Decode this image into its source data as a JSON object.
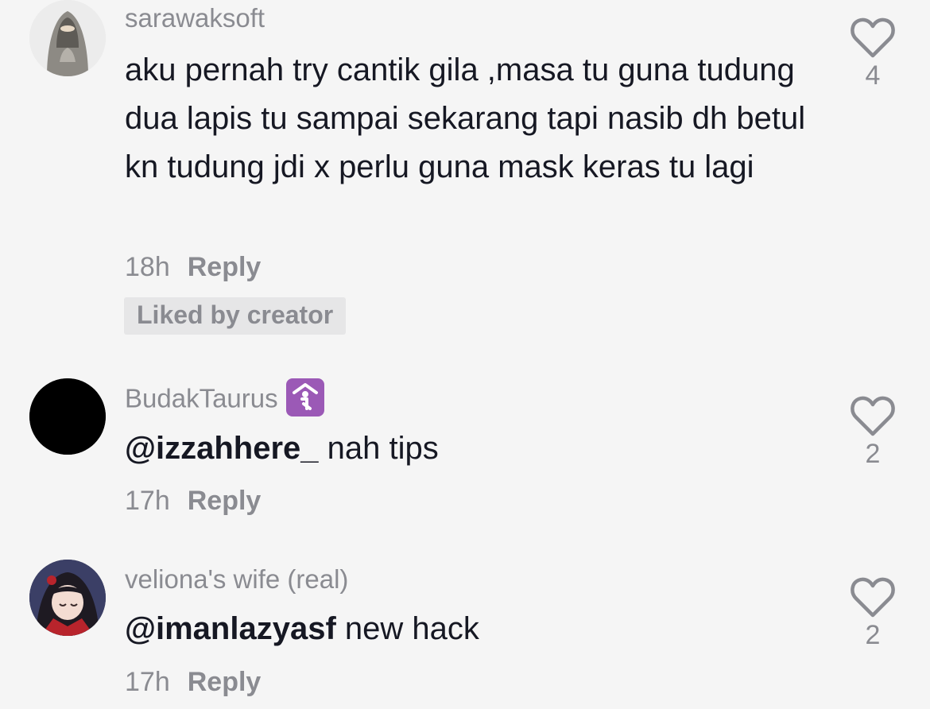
{
  "comments": [
    {
      "username": "sarawaksoft",
      "text": "aku pernah try cantik gila ,masa tu guna tudung dua lapis tu sampai sekarang tapi nasib dh betul kn tudung jdi x perlu guna mask keras tu lagi",
      "time": "18h",
      "reply_label": "Reply",
      "liked_by_creator": "Liked by creator",
      "likes": "4",
      "avatar_icon": "avatar-hijab-icon"
    },
    {
      "username": "BudakTaurus",
      "badge_icon": "place-of-worship-emoji-icon",
      "mention": "@izzahhere_",
      "text": " nah tips",
      "time": "17h",
      "reply_label": "Reply",
      "likes": "2",
      "avatar_icon": "avatar-black-icon"
    },
    {
      "username": "veliona's wife (real)",
      "mention": "@imanlazyasf",
      "text": " new hack",
      "time": "17h",
      "reply_label": "Reply",
      "likes": "2",
      "avatar_icon": "avatar-anime-icon"
    }
  ],
  "colors": {
    "background": "#f5f5f5",
    "primary_text": "#161823",
    "secondary_text": "#8a8b91",
    "badge_purple": "#9b59b6"
  }
}
